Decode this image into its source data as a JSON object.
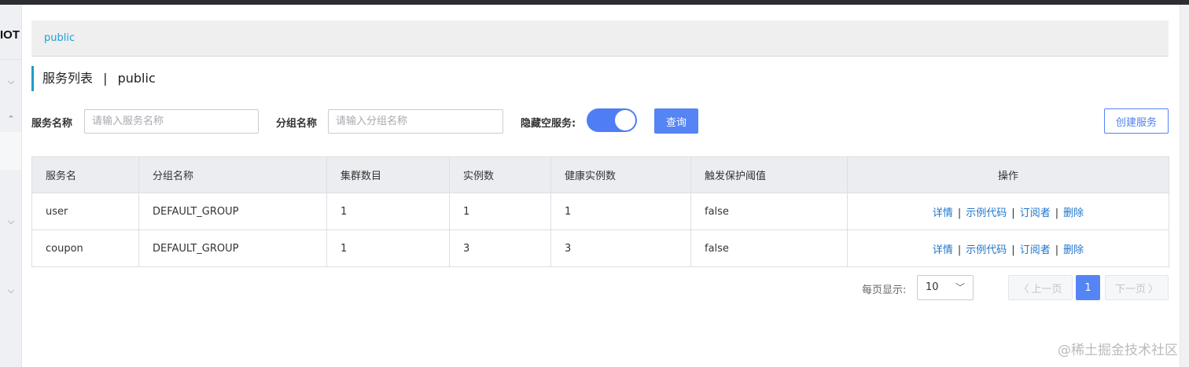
{
  "sidebar": {
    "brand": "IOT"
  },
  "namespace_bar": {
    "namespace": "public"
  },
  "page": {
    "title": "服务列表",
    "separator": "|",
    "namespace": "public"
  },
  "filters": {
    "service_label": "服务名称",
    "service_placeholder": "请输入服务名称",
    "group_label": "分组名称",
    "group_placeholder": "请输入分组名称",
    "hide_empty_label": "隐藏空服务:",
    "hide_empty_on": true,
    "query_label": "查询",
    "create_label": "创建服务"
  },
  "table": {
    "headers": [
      "服务名",
      "分组名称",
      "集群数目",
      "实例数",
      "健康实例数",
      "触发保护阈值",
      "操作"
    ],
    "rows": [
      {
        "name": "user",
        "group": "DEFAULT_GROUP",
        "clusters": "1",
        "instances": "1",
        "healthy": "1",
        "threshold": "false"
      },
      {
        "name": "coupon",
        "group": "DEFAULT_GROUP",
        "clusters": "1",
        "instances": "3",
        "healthy": "3",
        "threshold": "false"
      }
    ],
    "actions": {
      "detail": "详情",
      "sample": "示例代码",
      "subscribers": "订阅者",
      "delete": "删除",
      "sep": "|"
    }
  },
  "pagination": {
    "per_page_label": "每页显示:",
    "per_page_value": "10",
    "prev_label": "上一页",
    "next_label": "下一页",
    "current_page": "1"
  },
  "watermark": "@稀土掘金技术社区",
  "colors": {
    "primary": "#5584f5",
    "link": "#2276c9",
    "namespace": "#1ea0d8",
    "title_accent": "#209bc6"
  }
}
